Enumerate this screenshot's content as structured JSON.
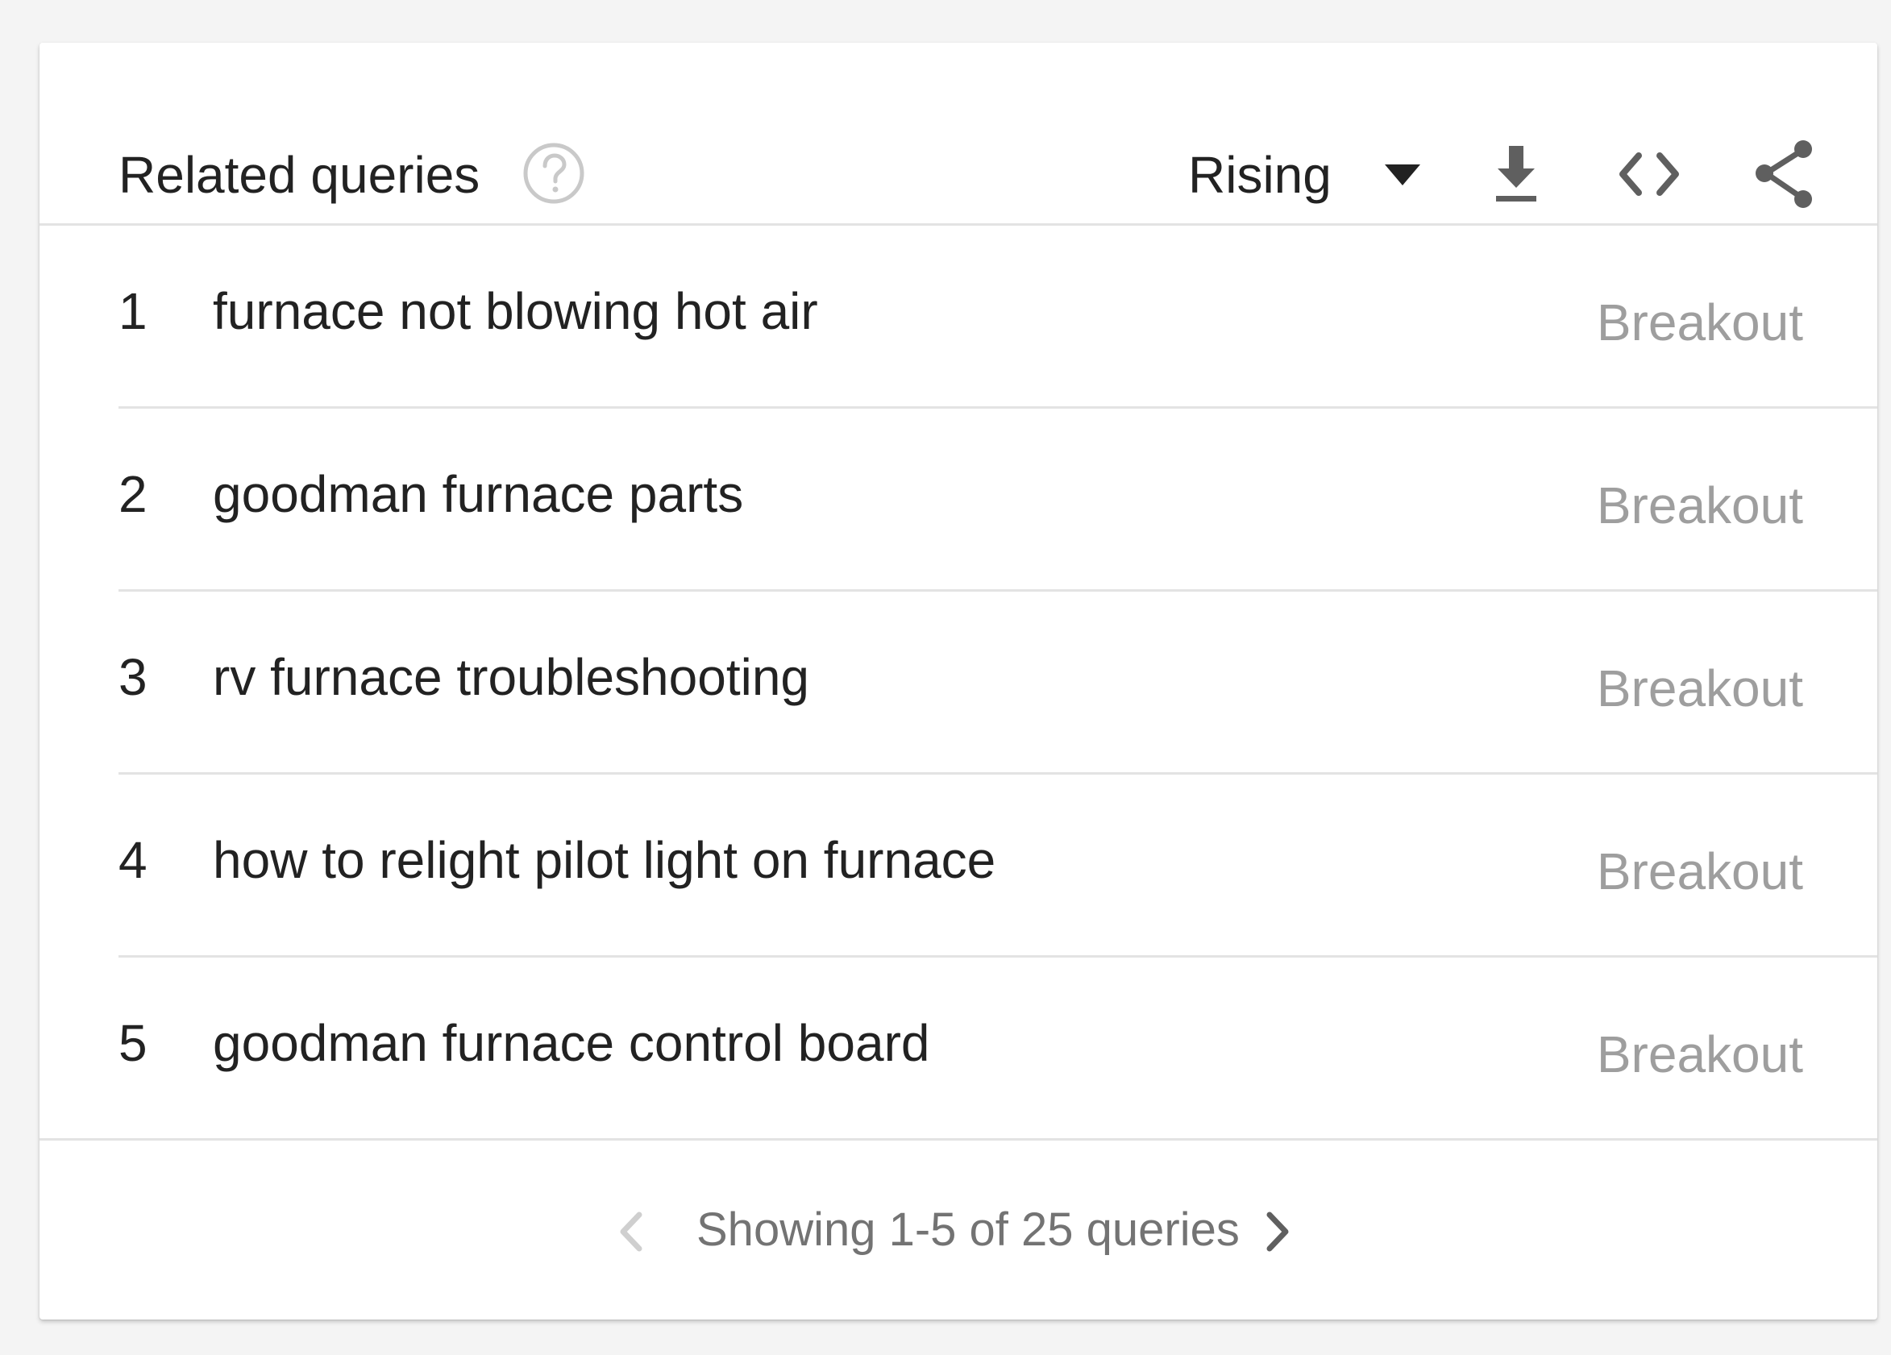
{
  "widget": {
    "title": "Related queries",
    "help_icon": "help-circle-icon",
    "metric_selector": {
      "selected": "Rising"
    },
    "toolbar_icons": [
      "download-icon",
      "embed-code-icon",
      "share-icon"
    ]
  },
  "queries": [
    {
      "rank": "1",
      "query": "furnace not blowing hot air",
      "value": "Breakout"
    },
    {
      "rank": "2",
      "query": "goodman furnace parts",
      "value": "Breakout"
    },
    {
      "rank": "3",
      "query": "rv furnace troubleshooting",
      "value": "Breakout"
    },
    {
      "rank": "4",
      "query": "how to relight pilot light on furnace",
      "value": "Breakout"
    },
    {
      "rank": "5",
      "query": "goodman furnace control board",
      "value": "Breakout"
    }
  ],
  "pagination": {
    "text": "Showing 1-5 of 25 queries",
    "prev_icon": "chevron-left-icon",
    "next_icon": "chevron-right-icon",
    "prev_enabled": false,
    "next_enabled": true
  },
  "colors": {
    "text_primary": "#222222",
    "text_muted": "#9e9e9e",
    "icon": "#5f5f5f",
    "icon_disabled": "#cfcfcf",
    "divider": "#e3e3e3",
    "background": "#f4f4f4",
    "card": "#ffffff"
  }
}
